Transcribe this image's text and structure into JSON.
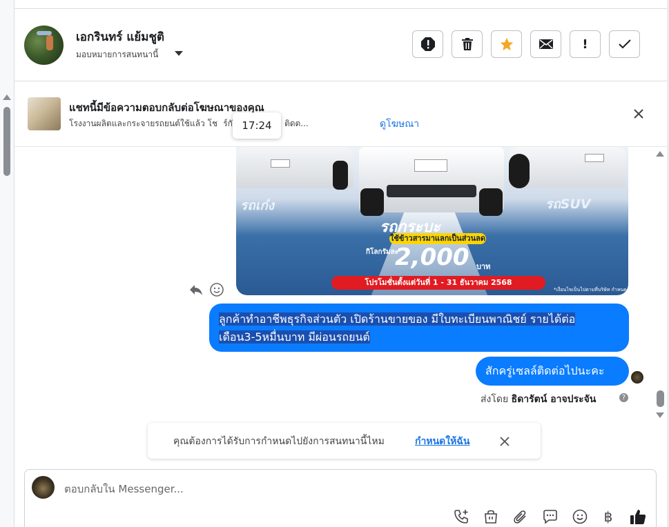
{
  "contact": {
    "name": "เอกรินทร์ แย้มชูติ",
    "assign_label": "มอบหมายการสนทนานี้"
  },
  "toolbar": {
    "buttons": [
      {
        "name": "report-icon"
      },
      {
        "name": "trash-icon"
      },
      {
        "name": "star-icon",
        "color": "#f5a623"
      },
      {
        "name": "mail-icon"
      },
      {
        "name": "exclamation-icon",
        "text": "!"
      },
      {
        "name": "check-icon"
      }
    ]
  },
  "ad_banner": {
    "title": "แชทนี้มีข้อความตอบกลับต่อโฆษณาของคุณ",
    "subtitle_left": "โรงงานผลิตและกระจายรถยนต์ใช้แล้ว โช",
    "subtitle_right": "ร์กับ สาธารณะ · ติดต...",
    "link": "ดูโฆษณา",
    "tooltip_time": "17:24"
  },
  "ad_image": {
    "label_sedan": "รถเก๋ง",
    "label_suv": "รถSUV",
    "label_pickup": "รถกระบะ",
    "pill": "ใช้ข้าวสารมาแลกเป็นส่วนลด",
    "kg_label": "กิโลกรัมละ",
    "amount": "2,000",
    "currency": "บาท",
    "promo": "โปรโมชั่นตั้งแต่วันที่ 1 - 31 ธันวาคม 2568",
    "fineprint": "*เงื่อนไขเป็นไปตามที่บริษัท กำหนด"
  },
  "messages": [
    {
      "text_line1": "ลูกค้าทำอาชีพธุรกิจส่วนตัว เปิดร้านขายของ มีใบทะเบียนพาณิชย์ รายได้ต่อ",
      "text_line2": "เดือน3-5หมื่นบาท มีผ่อนรถยนต์"
    },
    {
      "text": "สักครู่เซลล์ติดต่อไปนะคะ"
    }
  ],
  "sent_by": {
    "prefix": "ส่งโดย",
    "name": "ธิดารัตน์ อาจประจัน",
    "info": "?"
  },
  "reminder": {
    "text": "คุณต้องการได้รับการกำหนดไปยังการสนทนานี้ไหม",
    "link": "กำหนดให้ฉัน"
  },
  "composer": {
    "placeholder": "ตอบกลับใน Messenger...",
    "icons": [
      "call-add-icon",
      "shopping-bag-icon",
      "paperclip-icon",
      "chat-bubble-icon",
      "emoji-icon",
      "baht-icon",
      "thumbs-up-icon"
    ]
  },
  "colors": {
    "accent": "#0a7cff",
    "link": "#1b74e4",
    "star": "#f5a623"
  }
}
